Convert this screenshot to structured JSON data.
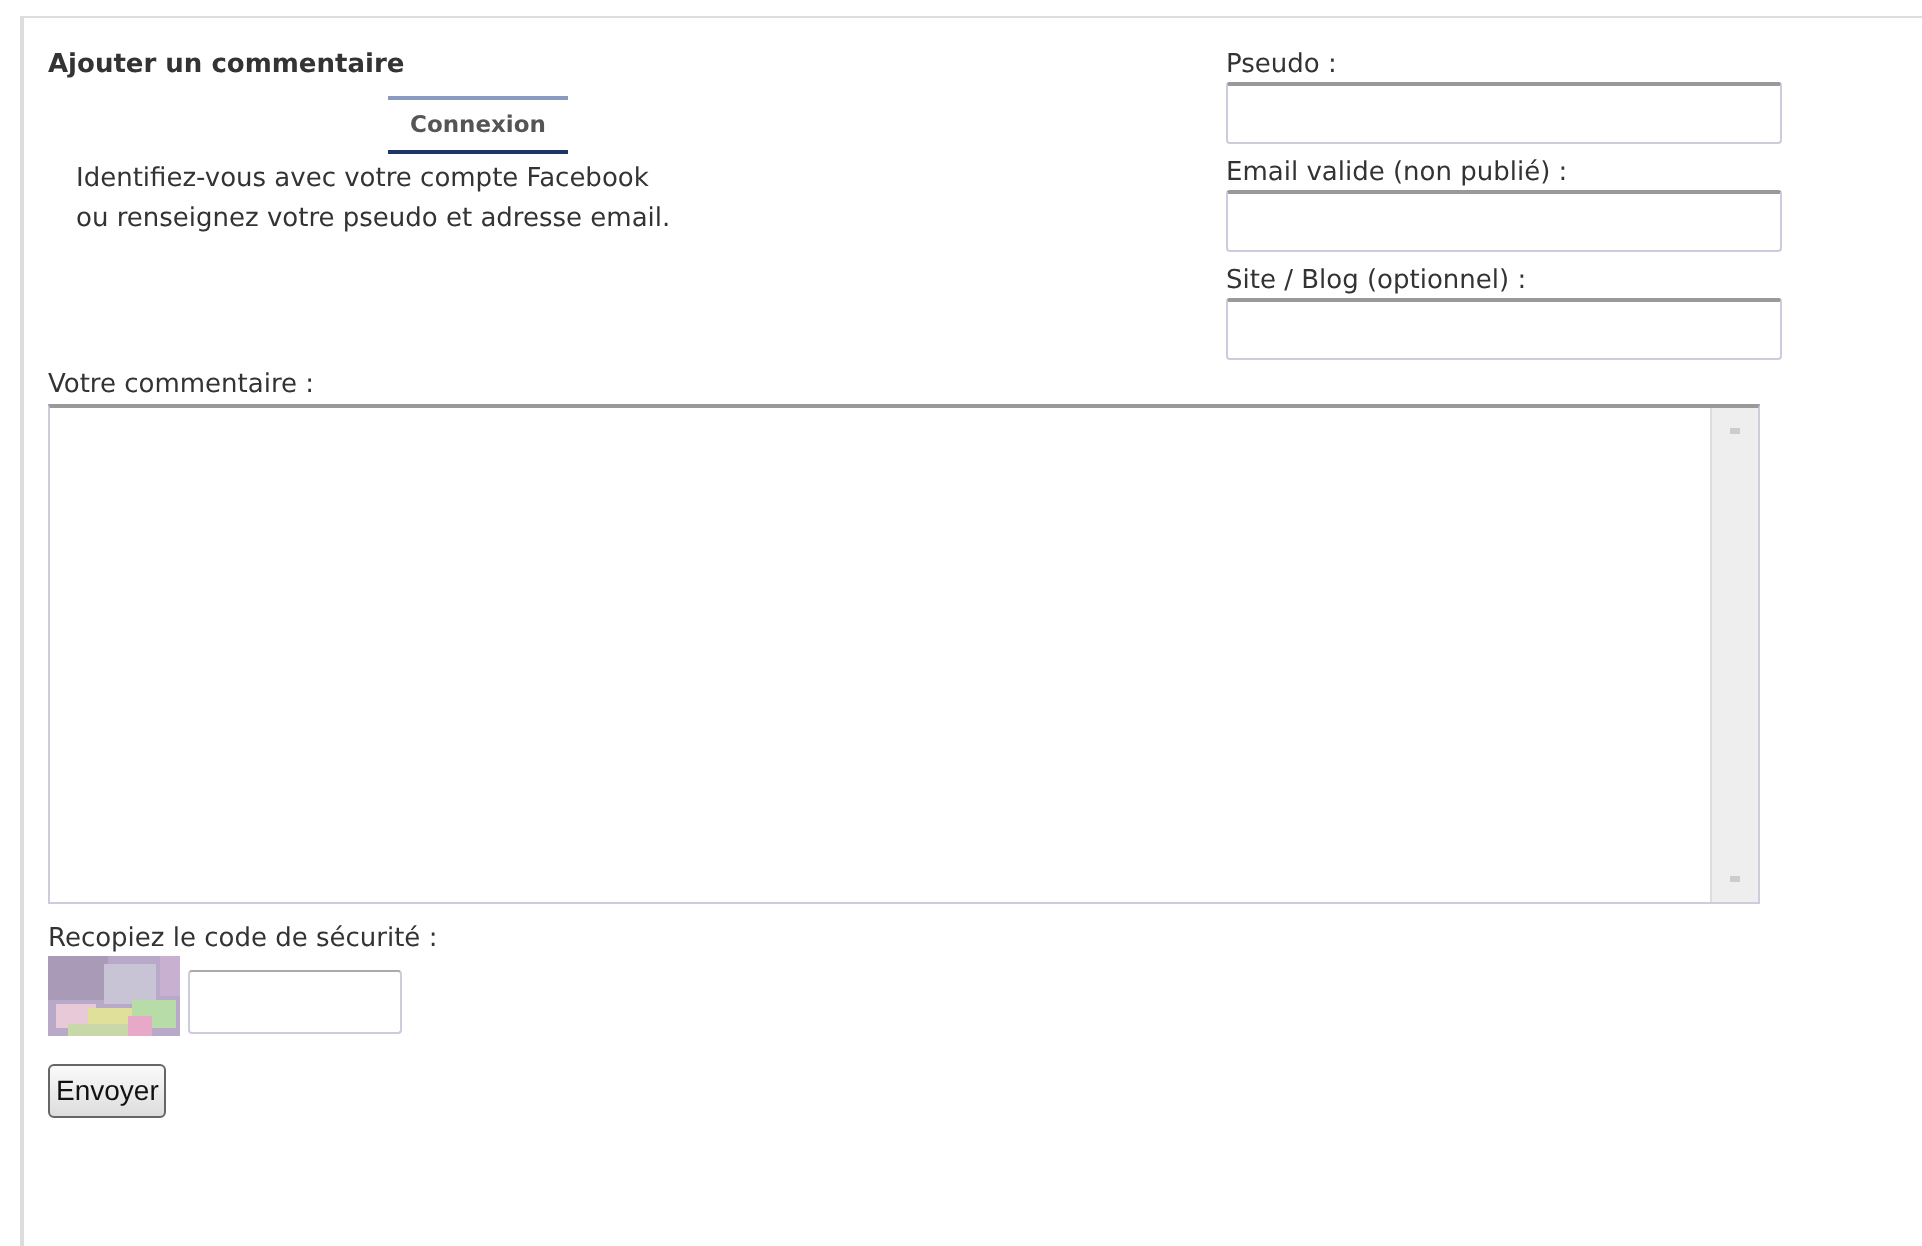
{
  "heading": "Ajouter un commentaire",
  "login_tab": {
    "label": "Connexion"
  },
  "login_text": [
    "Identifiez-vous avec votre compte Facebook",
    "ou renseignez votre pseudo et adresse email."
  ],
  "fields": [
    {
      "label": "Pseudo :"
    },
    {
      "label": "Email valide (non publié) :"
    },
    {
      "label": "Site / Blog (optionnel) :"
    }
  ],
  "comment": {
    "label": "Votre commentaire :"
  },
  "captcha": {
    "label": "Recopiez le code de sécurité :"
  },
  "submit": {
    "label": "Envoyer"
  }
}
